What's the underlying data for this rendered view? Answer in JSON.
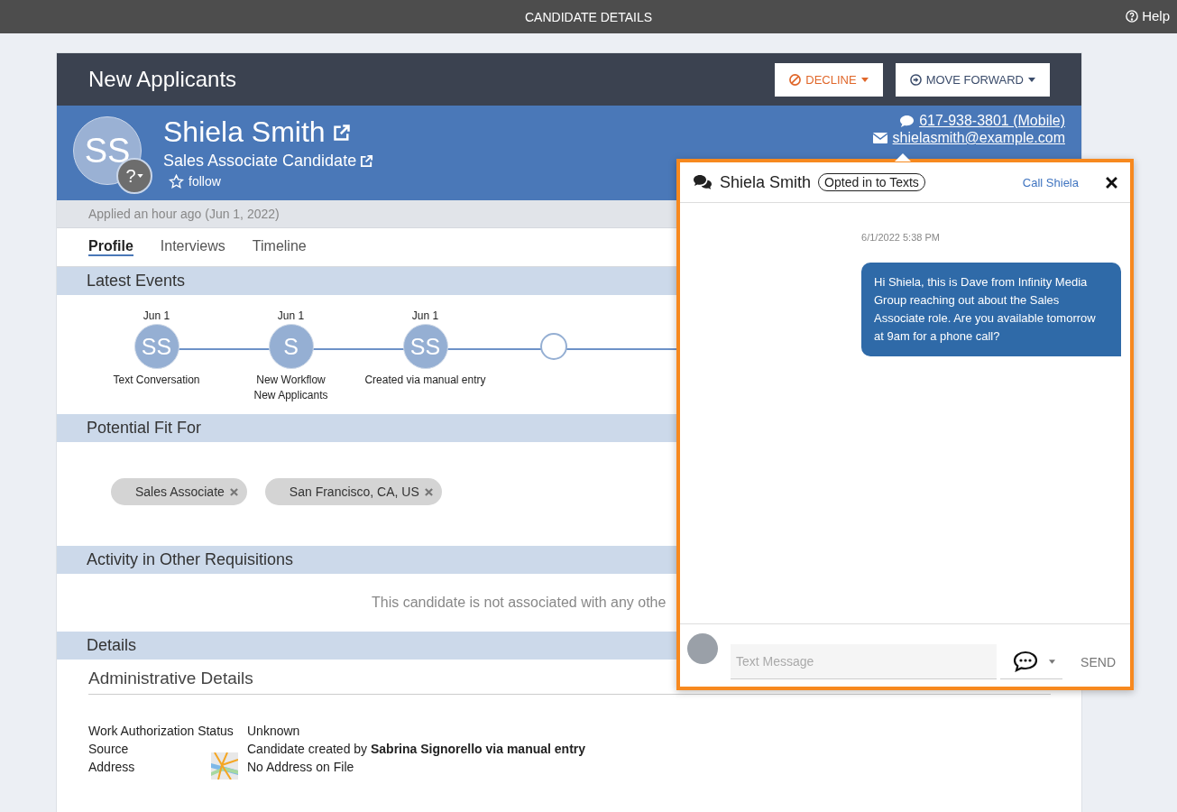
{
  "top_bar": {
    "title": "CANDIDATE DETAILS",
    "help": "Help"
  },
  "header": {
    "title": "New Applicants",
    "buttons": [
      {
        "label": "DECLINE",
        "kind": "decline"
      },
      {
        "label": "MOVE FORWARD",
        "kind": "forward"
      }
    ]
  },
  "candidate": {
    "initials": "SS",
    "status_badge": "?",
    "name": "Shiela Smith",
    "role": "Sales Associate Candidate",
    "follow": "follow",
    "phone": "617-938-3801 (Mobile)",
    "email": "shielasmith@example.com"
  },
  "applied": "Applied an hour ago (Jun 1, 2022)",
  "tabs": [
    {
      "label": "Profile",
      "selected": true
    },
    {
      "label": "Interviews",
      "selected": false
    },
    {
      "label": "Timeline",
      "selected": false
    }
  ],
  "latest_events": {
    "title": "Latest Events",
    "events": [
      {
        "kind": "event",
        "date": "Jun 1",
        "initials": "SS",
        "lines": [
          "Text Conversation"
        ]
      },
      {
        "kind": "event",
        "date": "Jun 1",
        "initials": "S",
        "lines": [
          "New Workflow",
          "New Applicants"
        ]
      },
      {
        "kind": "event",
        "date": "Jun 1",
        "initials": "SS",
        "lines": [
          "Created via manual entry"
        ]
      },
      {
        "kind": "empty"
      }
    ]
  },
  "potential_fit": {
    "title": "Potential Fit For",
    "tags": [
      "Sales Associate",
      "San Francisco, CA, US"
    ]
  },
  "other_requisitions": {
    "title": "Activity in Other Requisitions",
    "message": "This candidate is not associated with any othe"
  },
  "details": {
    "title": "Details",
    "subtitle": "Administrative Details",
    "rows": [
      {
        "kind": "text",
        "label": "Work Authorization Status",
        "value": "Unknown"
      },
      {
        "kind": "text",
        "label": "Source",
        "value": "Candidate created by **Sabrina Signorello via manual entry**"
      },
      {
        "kind": "map",
        "label": "Address",
        "value": "No Address on File"
      }
    ]
  },
  "chat": {
    "name": "Shiela Smith",
    "badge": "Opted in to Texts",
    "call": "Call Shiela",
    "messages": [
      {
        "time": "6/1/2022 5:38 PM",
        "text": "Hi Shiela, this is Dave from Infinity Media Group reaching out about the Sales Associate role. Are you available tomorrow at 9am for a phone call?"
      }
    ],
    "input": {
      "placeholder": "Text Message"
    },
    "send": "SEND"
  }
}
